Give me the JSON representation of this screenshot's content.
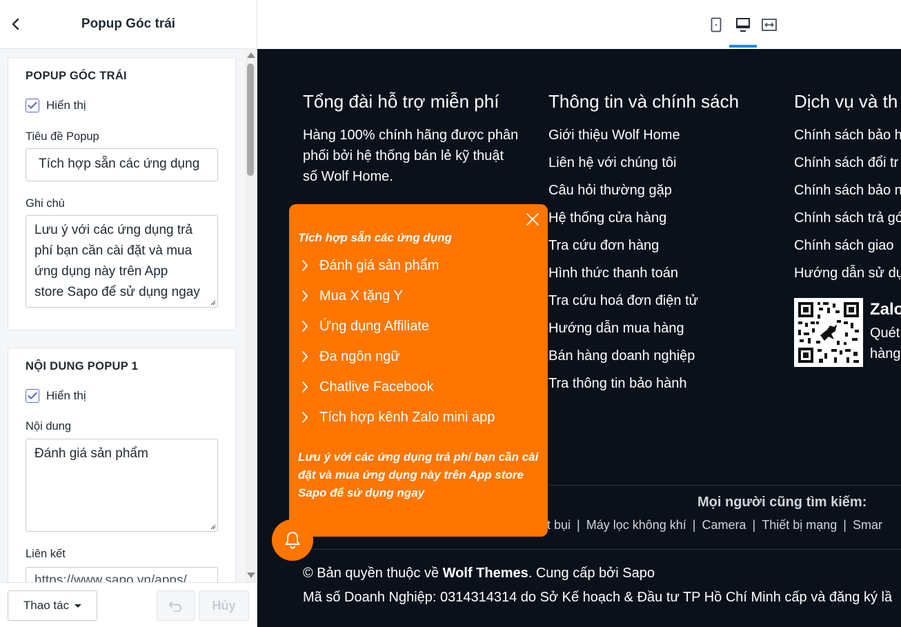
{
  "panel": {
    "title": "Popup Góc trái",
    "card1": {
      "heading": "POPUP GÓC TRÁI",
      "show_label": "Hiển thị",
      "show_checked": true,
      "popup_title_label": "Tiêu đề Popup",
      "popup_title_value": "Tích hợp sẵn các ứng dụng",
      "note_label": "Ghi chú",
      "note_lines": [
        "Lưu ý với các ứng dụng trả",
        "phí bạn cần cài đặt và mua",
        "ứng dụng này trên App",
        "store Sapo để sử dụng ngay"
      ]
    },
    "card2": {
      "heading": "NỘI DUNG POPUP 1",
      "show_label": "Hiển thị",
      "show_checked": true,
      "content_label": "Nội dung",
      "content_value": "Đánh giá sản phẩm",
      "link_label": "Liên kết",
      "link_value": "https://www.sapo.vn/apps/"
    },
    "footer": {
      "actions_label": "Thao tác",
      "cancel_label": "Hủy"
    }
  },
  "preview": {
    "col1": {
      "title": "Tổng đài hỗ trợ miễn phí",
      "text_lines": [
        "Hàng 100% chính hãng được phân",
        "phối bởi hệ thống bán lẻ kỹ thuật",
        "số Wolf Home."
      ]
    },
    "col2": {
      "title": "Thông tin và chính sách",
      "links": [
        "Giới thiệu Wolf Home",
        "Liên hệ với chúng tôi",
        "Câu hỏi thường gặp",
        "Hệ thống cửa hàng",
        "Tra cứu đơn hàng",
        "Hình thức thanh toán",
        "Tra cứu hoá đơn điện tử",
        "Hướng dẫn mua hàng",
        "Bán hàng doanh nghiệp",
        "Tra thông tin bảo hành"
      ]
    },
    "col3": {
      "title": "Dịch vụ và th",
      "links": [
        "Chính sách bảo h",
        "Chính sách đổi tr",
        "Chính sách bảo n",
        "Chính sách trả gó",
        "Chính sách giao",
        "Hướng dẫn sử dụ"
      ],
      "zalo_title": "Zalo",
      "zalo_lines": [
        "Quét",
        "hàng"
      ]
    },
    "search": {
      "title": "Mọi người cũng tìm kiếm:",
      "tags": [
        "t bụi",
        "Máy lọc không khí",
        "Camera",
        "Thiết bị mạng",
        "Smar"
      ]
    },
    "copyright_prefix": "© Bản quyền thuộc về ",
    "copyright_brand": "Wolf Themes",
    "copyright_suffix": ". Cung cấp bởi Sapo",
    "company_line": "Mã số Doanh Nghiệp: 0314314314 do Sở Kế hoạch & Đầu tư TP Hồ Chí Minh cấp và đăng ký lầ"
  },
  "popup": {
    "title": "Tích hợp sẵn các ứng dụng",
    "items": [
      "Đánh giá sản phẩm",
      "Mua X tặng Y",
      "Ứng dụng Affiliate",
      "Đa ngôn ngữ",
      "Chatlive Facebook",
      "Tích hợp kênh Zalo mini app"
    ],
    "note_lines": [
      "Lưu ý với các ứng dụng trả phí bạn cần cài",
      "đặt và mua ứng dụng này trên App store",
      "Sapo để sử dụng ngay"
    ],
    "color": "#fe7600"
  },
  "colors": {
    "footer_bg": "#0b111b",
    "accent": "#1a8ae5",
    "checkbox": "#5c6ac4"
  }
}
